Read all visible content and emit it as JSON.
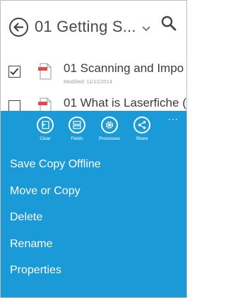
{
  "header": {
    "title": "01 Getting S..."
  },
  "list": [
    {
      "name": "01 Scanning and Impo",
      "modified": "Modified: 11/11/2014",
      "checked": true
    },
    {
      "name": "01 What is Laserfiche (",
      "checked": false
    }
  ],
  "appbar": {
    "more_label": "...",
    "commands": [
      {
        "label": "Clear",
        "icon": "clear-icon"
      },
      {
        "label": "Fields",
        "icon": "fields-icon"
      },
      {
        "label": "Processes",
        "icon": "gear-icon"
      },
      {
        "label": "Share",
        "icon": "share-icon"
      }
    ],
    "menu": [
      "Save Copy Offline",
      "Move or Copy",
      "Delete",
      "Rename",
      "Properties"
    ]
  },
  "colors": {
    "accent": "#1a9ad6",
    "doc_red": "#e8474c"
  }
}
